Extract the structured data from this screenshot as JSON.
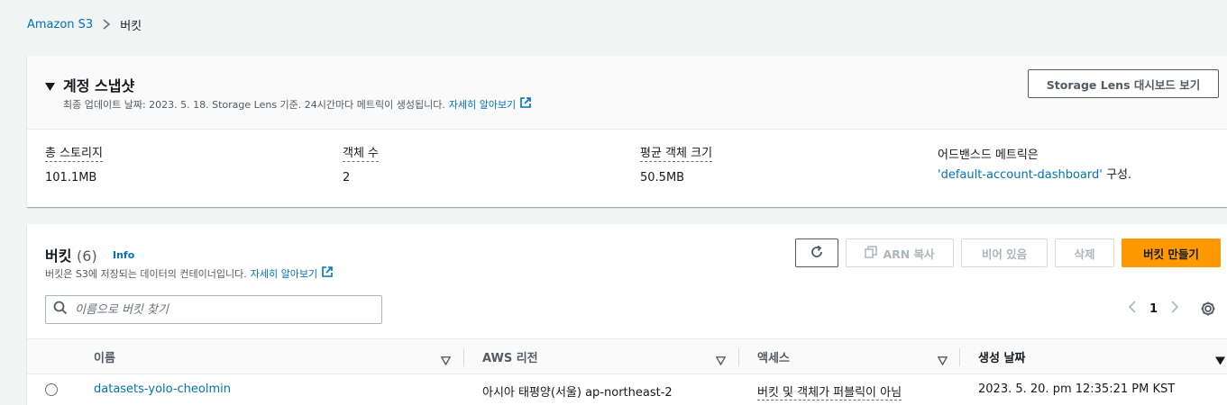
{
  "breadcrumb": {
    "root": "Amazon S3",
    "current": "버킷"
  },
  "snapshot": {
    "title": "계정 스냅샷",
    "subtitle": "최종 업데이트 날짜: 2023. 5. 18. Storage Lens 기준. 24시간마다 메트릭이 생성됩니다.",
    "learn_more": "자세히 알아보기",
    "dashboard_button": "Storage Lens 대시보드 보기",
    "metrics": [
      {
        "label": "총 스토리지",
        "value": "101.1MB"
      },
      {
        "label": "객체 수",
        "value": "2"
      },
      {
        "label": "평균 객체 크기",
        "value": "50.5MB"
      }
    ],
    "advanced_label": "어드밴스드 메트릭은",
    "advanced_link": "'default-account-dashboard'",
    "advanced_suffix": "구성."
  },
  "buckets": {
    "title": "버킷",
    "count": "(6)",
    "info": "Info",
    "subtitle": "버킷은 S3에 저장되는 데이터의 컨테이너입니다.",
    "learn_more": "자세히 알아보기",
    "buttons": {
      "copy_arn": "ARN 복사",
      "empty": "비어 있음",
      "delete": "삭제",
      "create": "버킷 만들기"
    },
    "search_placeholder": "이름으로 버킷 찾기",
    "page": "1",
    "columns": [
      "이름",
      "AWS 리전",
      "액세스",
      "생성 날짜"
    ],
    "rows": [
      {
        "name": "datasets-yolo-cheolmin",
        "region": "아시아 태평양(서울) ap-northeast-2",
        "access": "버킷 및 객체가 퍼블릭이 아님",
        "created": "2023. 5. 20. pm 12:35:21 PM KST"
      }
    ]
  },
  "colors": {
    "link": "#0073bb",
    "primary": "#ff9900",
    "background": "#f2f3f3"
  }
}
